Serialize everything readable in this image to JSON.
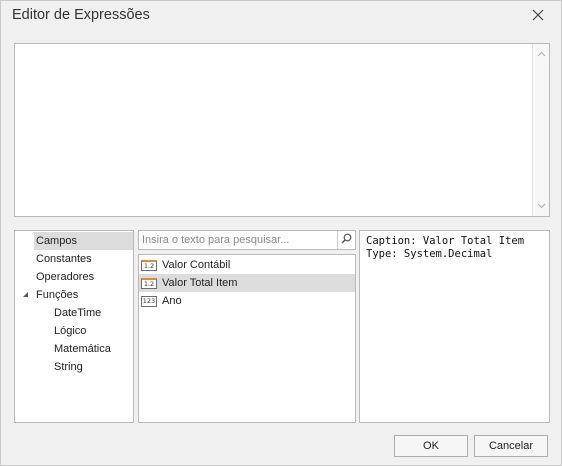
{
  "window": {
    "title": "Editor de Expressões"
  },
  "icons": {
    "close": "close-icon",
    "search": "search-icon",
    "expand": "triangle-down-icon"
  },
  "tree": {
    "items": [
      {
        "label": "Campos",
        "selected": true,
        "level": 0
      },
      {
        "label": "Constantes",
        "level": 0
      },
      {
        "label": "Operadores",
        "level": 0
      },
      {
        "label": "Funções",
        "level": 0,
        "expanded": true
      },
      {
        "label": "DateTime",
        "level": 1
      },
      {
        "label": "Lógico",
        "level": 1
      },
      {
        "label": "Matemática",
        "level": 1
      },
      {
        "label": "String",
        "level": 1
      }
    ]
  },
  "search": {
    "placeholder": "Insira o texto para pesquisar..."
  },
  "fields": {
    "items": [
      {
        "label": "Valor Contábil",
        "icon": "1.2",
        "type": "decimal"
      },
      {
        "label": "Valor Total Item",
        "icon": "1.2",
        "type": "decimal",
        "selected": true
      },
      {
        "label": "Ano",
        "icon": "123",
        "type": "integer"
      }
    ]
  },
  "info": {
    "line1": "Caption: Valor Total Item",
    "line2": "Type: System.Decimal"
  },
  "buttons": {
    "ok": "OK",
    "cancel": "Cancelar"
  }
}
